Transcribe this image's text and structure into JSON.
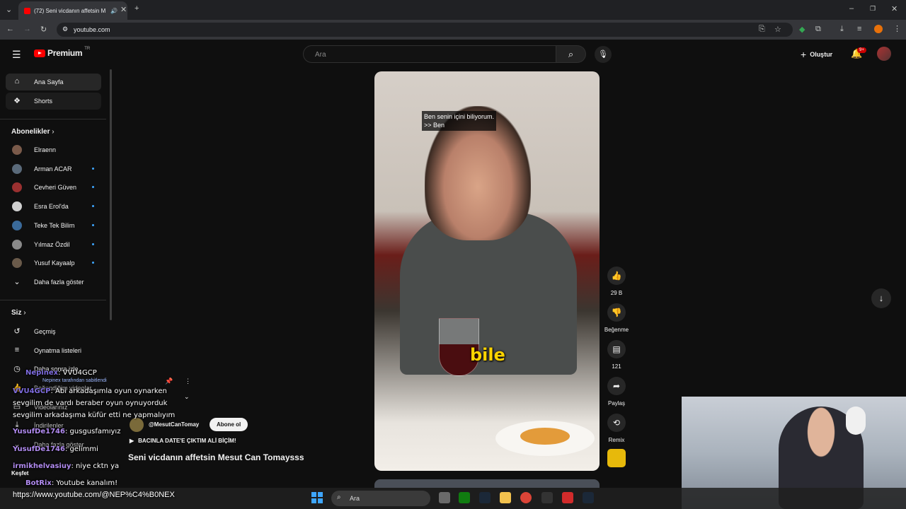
{
  "browser": {
    "tab_title": "(72) Seni vicdanın affetsin M",
    "url": "youtube.com"
  },
  "header": {
    "logo_text": "Premium",
    "region": "TR",
    "search_placeholder": "Ara",
    "create_label": "Oluştur",
    "notification_count": "9+"
  },
  "sidebar": {
    "home_label": "Ana Sayfa",
    "shorts_label": "Shorts",
    "subscriptions_title": "Abonelikler",
    "subscriptions": [
      {
        "name": "Elraenn",
        "color": "#7a5a4a",
        "new": false
      },
      {
        "name": "Arman ACAR",
        "color": "#5a6a7a",
        "new": true
      },
      {
        "name": "Cevheri Güven",
        "color": "#9a3030",
        "new": true
      },
      {
        "name": "Esra Erol'da",
        "color": "#d0d0d0",
        "new": true
      },
      {
        "name": "Teke Tek Bilim",
        "color": "#3a6a9a",
        "new": true
      },
      {
        "name": "Yılmaz Özdil",
        "color": "#8a8a8a",
        "new": true
      },
      {
        "name": "Yusuf Kayaalp",
        "color": "#6a5a4a",
        "new": true
      }
    ],
    "show_more": "Daha fazla göster",
    "you_title": "Siz",
    "history": "Geçmiş",
    "playlists": "Oynatma listeleri",
    "watch_later": "Daha sonra izle",
    "liked": "Beğendiğim videolar",
    "your_videos": "Videolarınız",
    "downloads": "İndirilenler",
    "show_more_2": "Daha fazla göster"
  },
  "short": {
    "caption_line1": "Ben senin içini biliyorum.",
    "caption_line2": ">> Ben",
    "overlay_word": "bile",
    "channel": "@MesutCanTomay",
    "subscribe": "Abone ol",
    "music": "BACINLA DATE'E ÇIKTIM ALİ BİÇİM!",
    "title": "Seni vicdanın affetsin Mesut Can Tomaysss",
    "likes": "29 B",
    "dislike_label": "Beğenme",
    "comments": "121",
    "share_label": "Paylaş",
    "remix_label": "Remix"
  },
  "chat": {
    "pinned_user": "Nepinex",
    "pinned_text": "VVU4GCP",
    "pinned_by": "Nepinex tarafından sabitlendi",
    "messages": [
      {
        "user": "VVU4GCP",
        "text": "Abi arkadaşımla oyun oynarken"
      },
      {
        "user": "",
        "text": "sevgilim de vardı beraber oyun oynuyorduk"
      },
      {
        "user": "",
        "text": "sevgilim arkadaşıma küfür etti ne yapmalıyım"
      },
      {
        "user": "YusufDe1746",
        "text": "gusgusfamıyız"
      },
      {
        "user": "YusufDe1746",
        "text": "gelimmi"
      },
      {
        "user": "irmikhelvasiuy",
        "text": "niye cktn ya"
      },
      {
        "user": "BotRix",
        "text": "Youtube kanalım!"
      }
    ],
    "link": "https://www.youtube.com/@NEP%C4%B0NEX",
    "kesfet": "Keşfet"
  },
  "taskbar": {
    "search_label": "Ara"
  }
}
